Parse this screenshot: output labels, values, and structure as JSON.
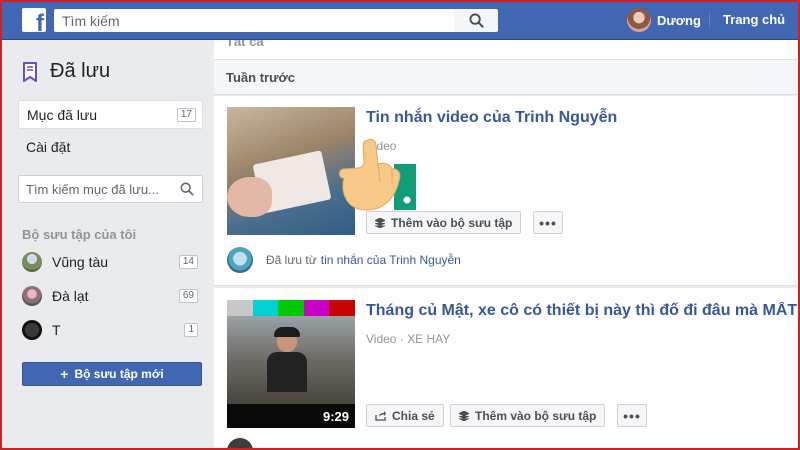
{
  "topbar": {
    "search_placeholder": "Tìm kiếm",
    "user_name": "Dương",
    "home_label": "Trang chủ",
    "brand_color": "#4267b2"
  },
  "sidebar": {
    "title": "Đã lưu",
    "menu": [
      {
        "label": "Mục đã lưu",
        "count": "17",
        "active": true
      },
      {
        "label": "Cài đặt"
      }
    ],
    "search_placeholder": "Tìm kiếm mục đã lưu...",
    "collections_title": "Bộ sưu tập của tôi",
    "collections": [
      {
        "label": "Vũng tàu",
        "count": "14"
      },
      {
        "label": "Đà lạt",
        "count": "69"
      },
      {
        "label": "T",
        "count": "1"
      }
    ],
    "new_collection_label": "Bộ sưu tập mới"
  },
  "main": {
    "cut_header": "Tất cả",
    "section_header": "Tuần trước",
    "items": [
      {
        "title": "Tin nhắn video của Trinh Nguyễn",
        "subtitle": "Video",
        "add_label": "Thêm vào bộ sưu tập",
        "more_label": "•••",
        "saved_from": "Đã lưu từ",
        "saved_from_link": "tin nhắn của Trinh Nguyễn"
      },
      {
        "title": "Tháng củ Mật, xe cô có thiết bị này thì đố đi đâu mà MẤT",
        "subtitle": "Video · XE HAY",
        "duration": "9:29",
        "share_label": "Chia sẻ",
        "add_label": "Thêm vào bộ sưu tập",
        "more_label": "•••"
      }
    ]
  },
  "icons": {
    "search": "search-icon",
    "bookmark": "bookmark-icon",
    "stack": "stack-icon",
    "share": "share-icon",
    "pointer": "pointing-hand-icon"
  }
}
